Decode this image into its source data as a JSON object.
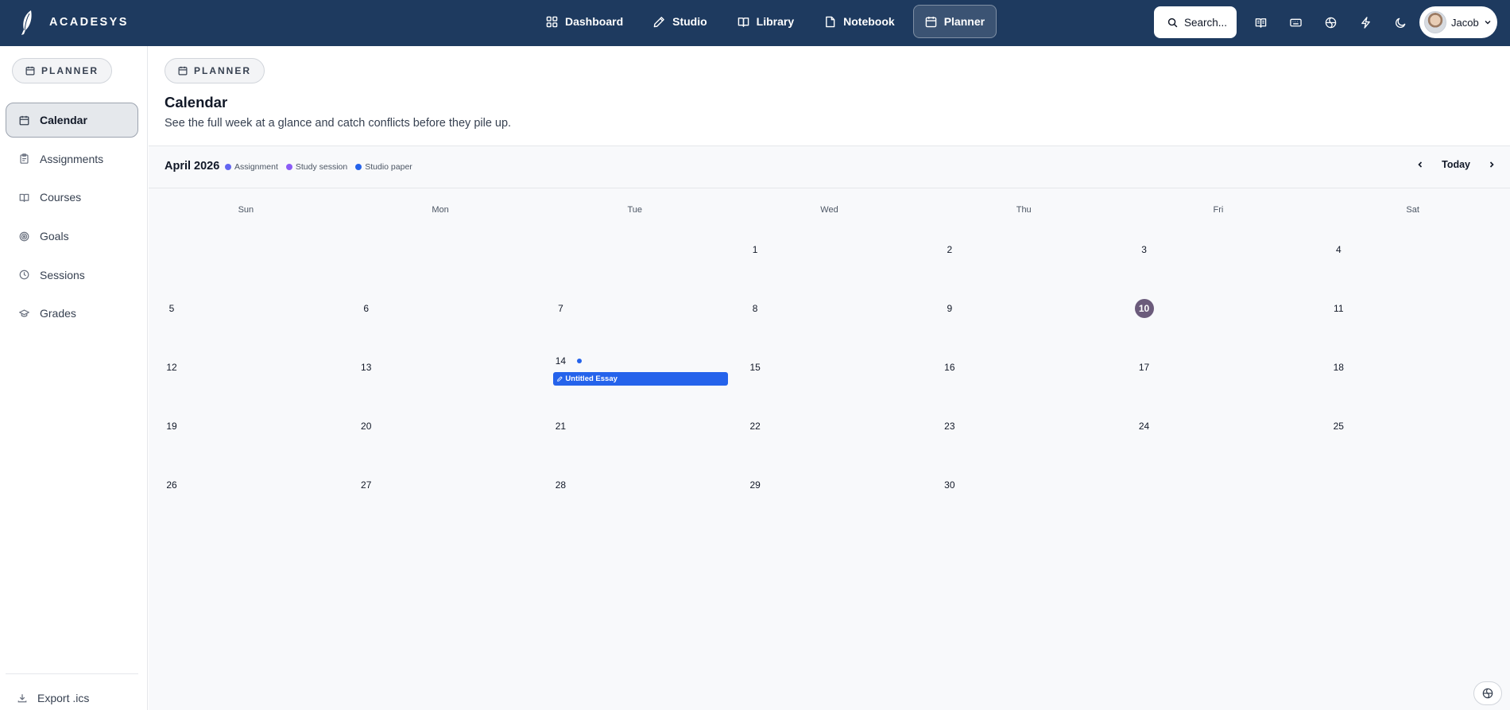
{
  "app": {
    "brand": "ACADESYS"
  },
  "topnav": {
    "items": [
      {
        "label": "Dashboard",
        "icon": "grid-icon"
      },
      {
        "label": "Studio",
        "icon": "pen-icon"
      },
      {
        "label": "Library",
        "icon": "book-open-icon"
      },
      {
        "label": "Notebook",
        "icon": "file-icon"
      },
      {
        "label": "Planner",
        "icon": "calendar-icon",
        "active": true
      }
    ],
    "search_label": "Search...",
    "tools": [
      "book-icon",
      "keyboard-icon",
      "globe-icon",
      "bolt-icon",
      "moon-icon"
    ],
    "user_name": "Jacob"
  },
  "sidebar": {
    "section_label": "PLANNER",
    "items": [
      {
        "label": "Calendar",
        "icon": "calendar-icon",
        "active": true
      },
      {
        "label": "Assignments",
        "icon": "clipboard-icon"
      },
      {
        "label": "Courses",
        "icon": "book-open-icon"
      },
      {
        "label": "Goals",
        "icon": "target-icon"
      },
      {
        "label": "Sessions",
        "icon": "clock-icon"
      },
      {
        "label": "Grades",
        "icon": "graduation-cap-icon"
      }
    ],
    "export_label": "Export .ics"
  },
  "main": {
    "section_label": "PLANNER",
    "title": "Calendar",
    "subtitle": "See the full week at a glance and catch conflicts before they pile up."
  },
  "calendar": {
    "month_label": "April 2026",
    "legend": [
      {
        "label": "Assignment",
        "color": "#6366f1"
      },
      {
        "label": "Study session",
        "color": "#8b5cf6"
      },
      {
        "label": "Studio paper",
        "color": "#2563eb"
      }
    ],
    "today_label": "Today",
    "weekdays": [
      "Sun",
      "Mon",
      "Tue",
      "Wed",
      "Thu",
      "Fri",
      "Sat"
    ],
    "weeks": [
      [
        null,
        null,
        null,
        1,
        2,
        3,
        4
      ],
      [
        5,
        6,
        7,
        8,
        9,
        10,
        11
      ],
      [
        12,
        13,
        14,
        15,
        16,
        17,
        18
      ],
      [
        19,
        20,
        21,
        22,
        23,
        24,
        25
      ],
      [
        26,
        27,
        28,
        29,
        30,
        null,
        null
      ]
    ],
    "today": 10,
    "today_color": "#6b5b7b",
    "events": [
      {
        "day": 14,
        "title": "Untitled Essay",
        "type": "Studio paper",
        "color": "#2563eb",
        "icon": "pen-icon"
      }
    ]
  }
}
